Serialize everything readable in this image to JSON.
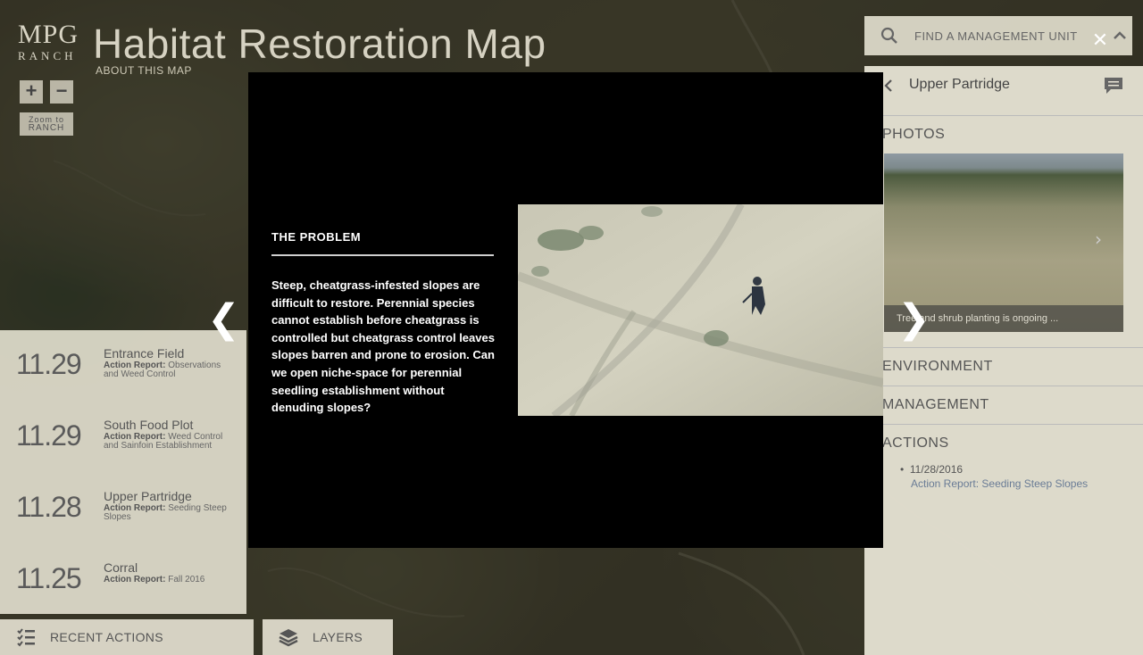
{
  "header": {
    "logo_mpg": "MPG",
    "logo_ranch": "RANCH",
    "title": "Habitat Restoration Map",
    "about_link": "ABOUT THIS MAP"
  },
  "zoom": {
    "in_label": "+",
    "out_label": "−",
    "ranch_line1": "Zoom to",
    "ranch_line2": "RANCH"
  },
  "recent_actions": [
    {
      "date": "11.29",
      "title": "Entrance Field",
      "label": "Action Report:",
      "detail": "Observations and Weed Control"
    },
    {
      "date": "11.29",
      "title": "South Food Plot",
      "label": "Action Report:",
      "detail": "Weed Control and Sainfoin Establishment"
    },
    {
      "date": "11.28",
      "title": "Upper Partridge",
      "label": "Action Report:",
      "detail": "Seeding Steep Slopes"
    },
    {
      "date": "11.25",
      "title": "Corral",
      "label": "Action Report:",
      "detail": "Fall 2016"
    }
  ],
  "bottom_tabs": {
    "recent": "RECENT ACTIONS",
    "layers": "LAYERS"
  },
  "search": {
    "placeholder": "FIND A MANAGEMENT UNIT"
  },
  "right_panel": {
    "unit_name": "Upper Partridge",
    "photos_label": "PHOTOS",
    "photo_caption": "Tree and shrub planting is ongoing ...",
    "environment_label": "ENVIRONMENT",
    "management_label": "MANAGEMENT",
    "actions_label": "ACTIONS",
    "action_date": "11/28/2016",
    "action_label": "Action Report:",
    "action_detail": "Seeding Steep Slopes"
  },
  "modal": {
    "heading": "THE PROBLEM",
    "body": "Steep, cheatgrass-infested slopes are difficult to restore. Perennial species cannot establish before cheatgrass is controlled but cheatgrass control leaves slopes barren and prone to erosion. Can we open niche-space for perennial seedling establishment without denuding slopes?",
    "prev_glyph": "❮",
    "next_glyph": "❯",
    "close_glyph": "✕"
  }
}
